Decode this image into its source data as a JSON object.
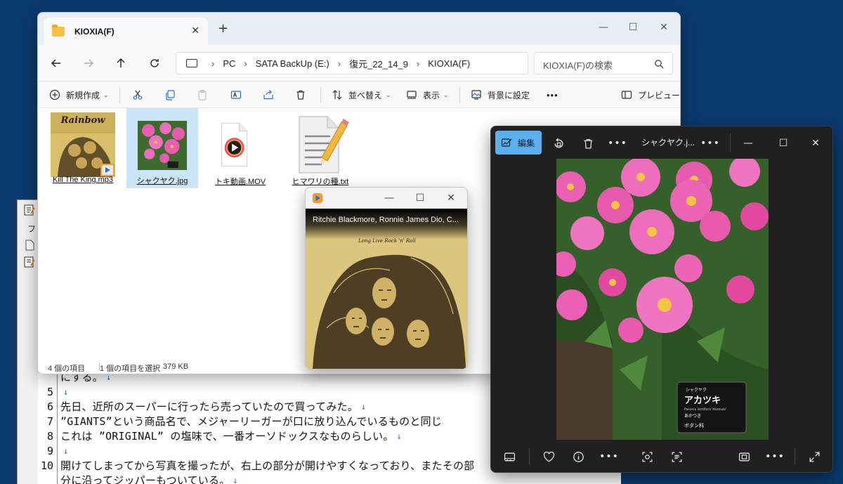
{
  "editor": {
    "menu_label": "ファ",
    "top_line_text": "にする。",
    "lines": [
      {
        "num": "5",
        "text": ""
      },
      {
        "num": "6",
        "text": "先日、近所のスーパーに行ったら売っていたので買ってみた。"
      },
      {
        "num": "7",
        "text": "”GIANTS”という商品名で、メジャーリーガーが口に放り込んでいるものと同じ"
      },
      {
        "num": "8",
        "text": "これは ”ORIGINAL” の塩味で、一番オーソドックスなものらしい。"
      },
      {
        "num": "9",
        "text": ""
      },
      {
        "num": "10",
        "text": "開けてしまってから写真を撮ったが、右上の部分が開けやすくなっており、またその部"
      },
      {
        "num": "",
        "text": "分に沿ってジッパーもついている。"
      }
    ]
  },
  "explorer": {
    "tab_title": "KIOXIA(F)",
    "tab_close": "✕",
    "new_tab": "+",
    "breadcrumb": [
      "PC",
      "SATA BackUp (E:)",
      "復元_22_14_9",
      "KIOXIA(F)"
    ],
    "search_placeholder": "KIOXIA(F)の検索",
    "commands": {
      "new": "新規作成",
      "sort": "並べ替え",
      "view": "表示",
      "set_background": "背景に設定",
      "more": "•••",
      "preview": "プレビュー"
    },
    "files": [
      {
        "name": "Kill The King.mp3",
        "type": "audio",
        "selected": false
      },
      {
        "name": "シャクヤク.jpg",
        "type": "image",
        "selected": true
      },
      {
        "name": "トキ動画.MOV",
        "type": "video",
        "selected": false
      },
      {
        "name": "ヒマワリの種.txt",
        "type": "text",
        "selected": false
      }
    ],
    "status": {
      "item_count": "4 個の項目",
      "selected": "1 個の項目を選択",
      "size": "379 KB"
    }
  },
  "mini_player": {
    "track_info": "Ritchie Blackmore, Ronnie James Dio, C...",
    "album_title": "Long Live Rock 'n' Roll"
  },
  "album_cover": {
    "band": "Rainbow"
  },
  "photos": {
    "edit_label": "編集",
    "file_name": "シャクヤク.j...",
    "more": "•••",
    "sign": {
      "kana": "シャクヤク",
      "name": "アカツキ",
      "latin": "Paeonia lactiflora 'Akatsuki'",
      "hiragana": "あかつき",
      "family": "ボタン科"
    }
  },
  "colors": {
    "desktop": "#0b3a6e",
    "accent": "#5cb0ef",
    "selection": "#cce4f7",
    "flower_pink": "#ec5fb5"
  }
}
